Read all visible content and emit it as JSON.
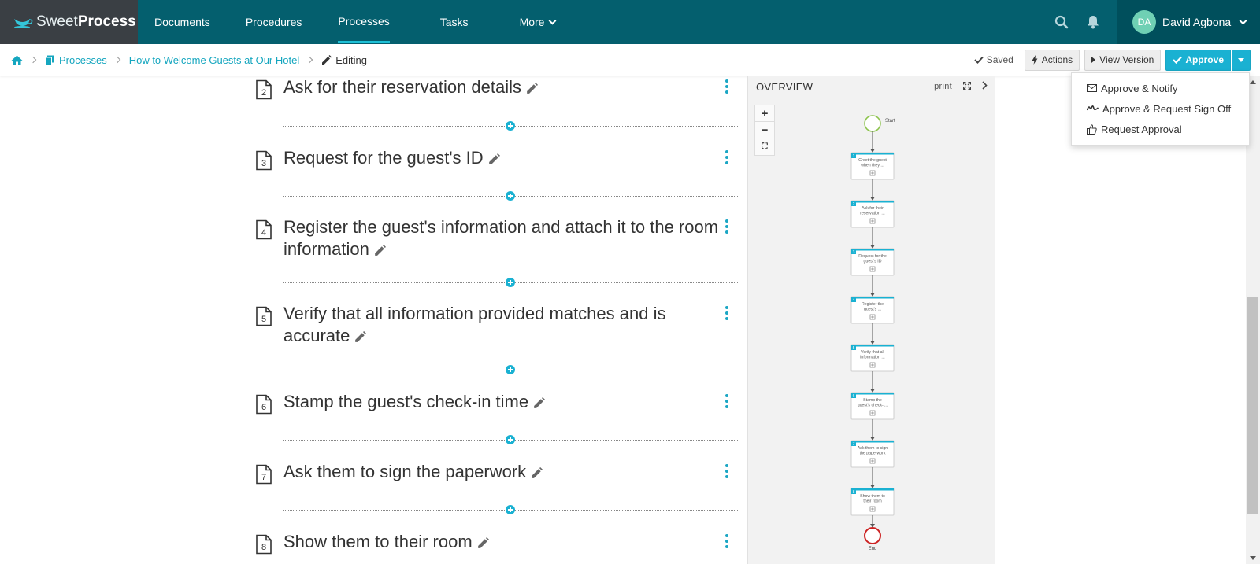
{
  "brand": {
    "name_light": "Sweet",
    "name_bold": "Process"
  },
  "nav": {
    "items": [
      {
        "label": "Documents"
      },
      {
        "label": "Procedures"
      },
      {
        "label": "Processes",
        "active": true
      },
      {
        "label": "Tasks"
      },
      {
        "label": "More"
      }
    ],
    "user": {
      "initials": "DA",
      "name": "David Agbona"
    }
  },
  "breadcrumb": {
    "items": [
      "Processes",
      "How to Welcome Guests at Our Hotel"
    ],
    "current": "Editing"
  },
  "toolbar": {
    "saved_label": "Saved",
    "actions_label": "Actions",
    "view_version_label": "View Version",
    "approve_label": "Approve"
  },
  "approve_menu": {
    "items": [
      "Approve & Notify",
      "Approve & Request Sign Off",
      "Request Approval"
    ]
  },
  "steps": [
    {
      "number": "2",
      "title": "Ask for their reservation details"
    },
    {
      "number": "3",
      "title": "Request for the guest's ID"
    },
    {
      "number": "4",
      "title": "Register the guest's information and attach it to the room information"
    },
    {
      "number": "5",
      "title": "Verify that all information provided matches and is accurate"
    },
    {
      "number": "6",
      "title": "Stamp the guest's check-in time"
    },
    {
      "number": "7",
      "title": "Ask them to sign the paperwork"
    },
    {
      "number": "8",
      "title": "Show them to their room"
    }
  ],
  "overview": {
    "title": "OVERVIEW",
    "print_label": "print",
    "zoom_in": "+",
    "zoom_out": "−",
    "fit": "⛶",
    "start_label": "Start",
    "end_label": "End",
    "nodes": [
      {
        "number": "1",
        "line1": "Greet the guest",
        "line2": "when they ..."
      },
      {
        "number": "2",
        "line1": "Ask for their",
        "line2": "reservation ..."
      },
      {
        "number": "3",
        "line1": "Request for the",
        "line2": "guest's ID"
      },
      {
        "number": "4",
        "line1": "Register the",
        "line2": "guest's ..."
      },
      {
        "number": "5",
        "line1": "Verify that all",
        "line2": "information ..."
      },
      {
        "number": "6",
        "line1": "Stamp the",
        "line2": "guest's check-i..."
      },
      {
        "number": "7",
        "line1": "Ask them to sign",
        "line2": "the paperwork"
      },
      {
        "number": "8",
        "line1": "Show them to",
        "line2": "their room"
      }
    ]
  },
  "colors": {
    "nav_bg": "#045f6e",
    "accent": "#1ab1d2",
    "link": "#15a6bf",
    "end_node": "#cc2222",
    "start_node": "#8bc34a"
  }
}
